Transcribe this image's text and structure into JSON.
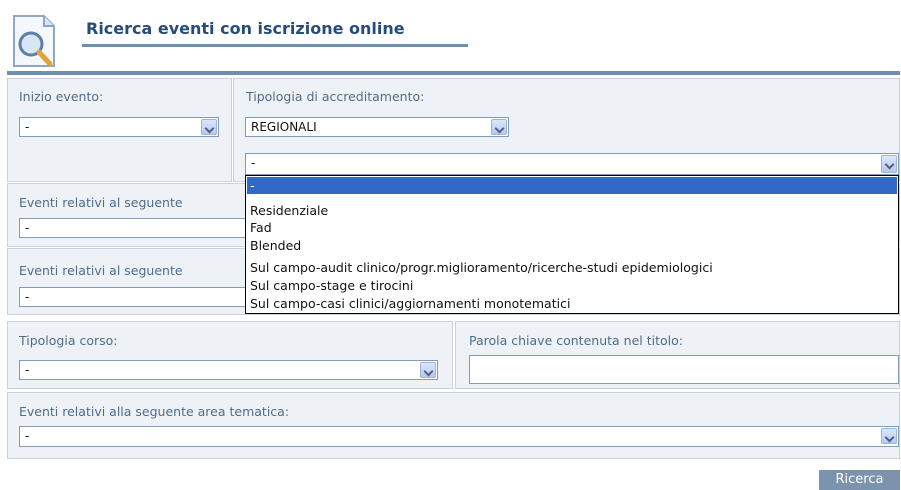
{
  "header": {
    "title": "Ricerca eventi con iscrizione online"
  },
  "fields": {
    "inizio_evento": {
      "label": "Inizio evento:",
      "value": "-"
    },
    "tipologia_accreditamento": {
      "label": "Tipologia di accreditamento:",
      "value": "REGIONALI",
      "sub_value": "-"
    },
    "eventi_seguente_1": {
      "label": "Eventi relativi al seguente",
      "value": "-"
    },
    "eventi_seguente_2": {
      "label": "Eventi relativi al seguente",
      "value": "-"
    },
    "tipologia_corso": {
      "label": "Tipologia corso:",
      "value": "-"
    },
    "parola_chiave": {
      "label": "Parola chiave contenuta nel titolo:",
      "value": ""
    },
    "area_tematica": {
      "label": "Eventi relativi alla seguente area tematica:",
      "value": "-"
    }
  },
  "dropdown": {
    "options": [
      "-",
      "Residenziale",
      "Fad",
      "Blended",
      "Sul campo-audit clinico/progr.miglioramento/ricerche-studi epidemiologici",
      "Sul campo-stage e tirocini",
      "Sul campo-casi clinici/aggiornamenti monotematici"
    ],
    "selected_index": 0
  },
  "actions": {
    "search_label": "Ricerca"
  }
}
